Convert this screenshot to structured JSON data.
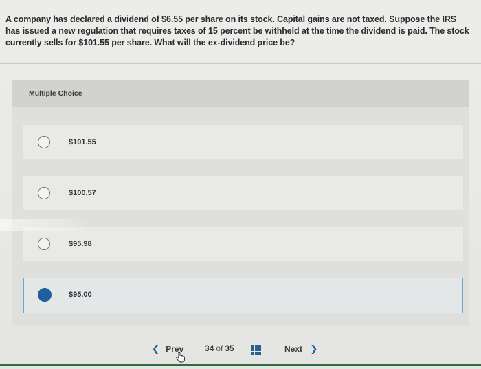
{
  "question": {
    "text": "A company has declared a dividend of $6.55 per share on its stock. Capital gains are not taxed. Suppose the IRS has issued a new regulation that requires taxes of 15 percent be withheld at the time the dividend is paid. The stock currently sells for $101.55 per share. What will the ex-dividend price be?"
  },
  "multiple_choice": {
    "header": "Multiple Choice",
    "options": [
      {
        "label": "$101.55",
        "selected": false
      },
      {
        "label": "$100.57",
        "selected": false
      },
      {
        "label": "$95.98",
        "selected": false
      },
      {
        "label": "$95.00",
        "selected": true
      }
    ]
  },
  "navigation": {
    "prev_label": "Prev",
    "current": "34",
    "of_label": "of",
    "total": "35",
    "next_label": "Next",
    "prev_icon": "chevron-left-icon",
    "next_icon": "chevron-right-icon",
    "grid_icon": "question-grid-icon"
  },
  "colors": {
    "accent": "#1e5f9c",
    "selected_border": "#6ea6c9"
  }
}
